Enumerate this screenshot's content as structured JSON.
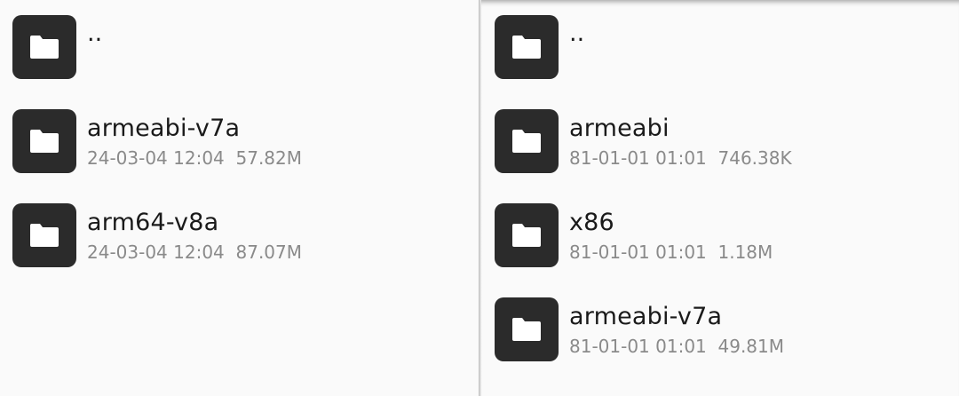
{
  "left_pane": {
    "items": [
      {
        "name": "..",
        "date": "",
        "size": ""
      },
      {
        "name": "armeabi-v7a",
        "date": "24-03-04 12:04",
        "size": "57.82M"
      },
      {
        "name": "arm64-v8a",
        "date": "24-03-04 12:04",
        "size": "87.07M"
      }
    ]
  },
  "right_pane": {
    "items": [
      {
        "name": "..",
        "date": "",
        "size": ""
      },
      {
        "name": "armeabi",
        "date": "81-01-01 01:01",
        "size": "746.38K"
      },
      {
        "name": "x86",
        "date": "81-01-01 01:01",
        "size": "1.18M"
      },
      {
        "name": "armeabi-v7a",
        "date": "81-01-01 01:01",
        "size": "49.81M"
      }
    ]
  },
  "icons": {
    "folder": "folder-icon"
  },
  "colors": {
    "background": "#fafafa",
    "icon_tile": "#2b2b2b",
    "name_text": "#1a1a1a",
    "meta_text": "#8a8a8a"
  }
}
